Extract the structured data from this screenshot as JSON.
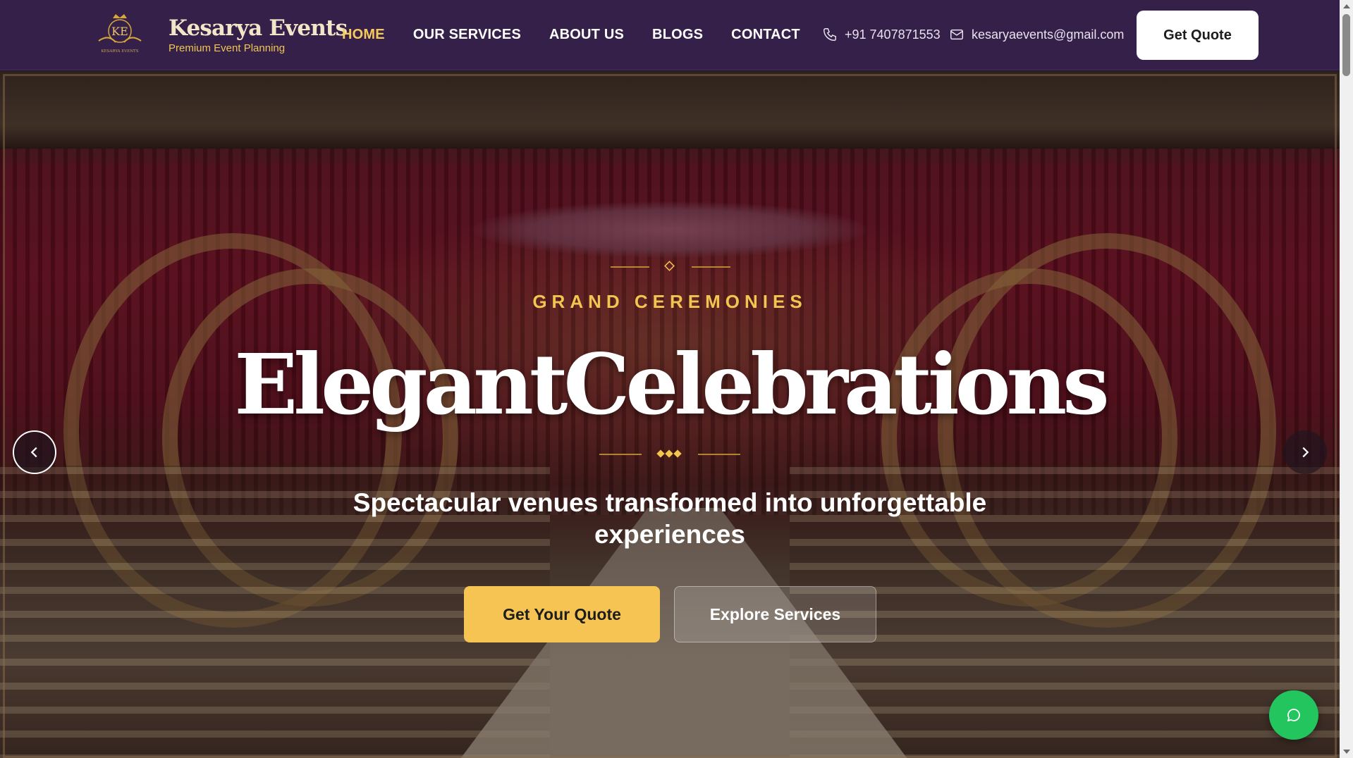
{
  "header": {
    "brand_name": "Kesarya Events",
    "brand_tagline": "Premium Event Planning",
    "logo_text": "KE",
    "logo_subtext": "KESARYA EVENTS",
    "nav": [
      {
        "label": "HOME",
        "active": true
      },
      {
        "label": "OUR SERVICES",
        "active": false
      },
      {
        "label": "ABOUT US",
        "active": false
      },
      {
        "label": "BLOGS",
        "active": false
      },
      {
        "label": "CONTACT",
        "active": false
      }
    ],
    "phone": "+91 7407871553",
    "email": "kesaryaevents@gmail.com",
    "quote_button": "Get Quote"
  },
  "hero": {
    "eyebrow": "GRAND CEREMONIES",
    "headline": "ElegantCelebrations",
    "subtitle": "Spectacular venues transformed into unforgettable experiences",
    "primary_cta": "Get Your Quote",
    "secondary_cta": "Explore Services"
  },
  "icons": {
    "phone": "phone-icon",
    "email": "mail-icon",
    "prev": "chevron-left-icon",
    "next": "chevron-right-icon",
    "chat": "chat-bubble-icon"
  },
  "colors": {
    "header_bg": "#35204a",
    "accent_gold": "#f5c95a",
    "cta_gold": "#f6c453",
    "chat_green": "#22c55e"
  }
}
